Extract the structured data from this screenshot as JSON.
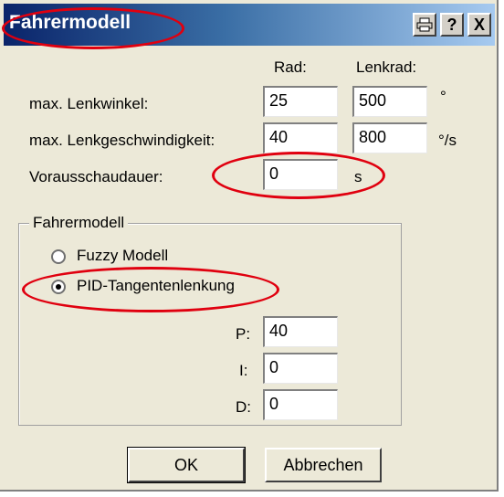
{
  "window": {
    "title": "Fahrermodell",
    "buttons": {
      "print_icon": "printer-icon",
      "help_label": "?",
      "close_label": "X"
    }
  },
  "columns": {
    "wheel": "Rad:",
    "steering_wheel": "Lenkrad:"
  },
  "rows": {
    "max_angle": {
      "label": "max. Lenkwinkel:",
      "wheel": "25",
      "steer": "500",
      "unit": "°"
    },
    "max_speed": {
      "label": "max. Lenkgeschwindigkeit:",
      "wheel": "40",
      "steer": "800",
      "unit": "°/s"
    },
    "lookahead": {
      "label": "Vorausschaudauer:",
      "value": "0",
      "unit": "s"
    }
  },
  "group": {
    "title": "Fahrermodell",
    "fuzzy_label": "Fuzzy Modell",
    "pid_label": "PID-Tangentenlenkung",
    "selected": "PID-Tangentenlenkung",
    "p_label": "P:",
    "p_value": "40",
    "i_label": "I:",
    "i_value": "0",
    "d_label": "D:",
    "d_value": "0"
  },
  "actions": {
    "ok": "OK",
    "cancel": "Abbrechen"
  },
  "colors": {
    "annotation": "#e0000f",
    "titlebar": "#0a246a"
  }
}
